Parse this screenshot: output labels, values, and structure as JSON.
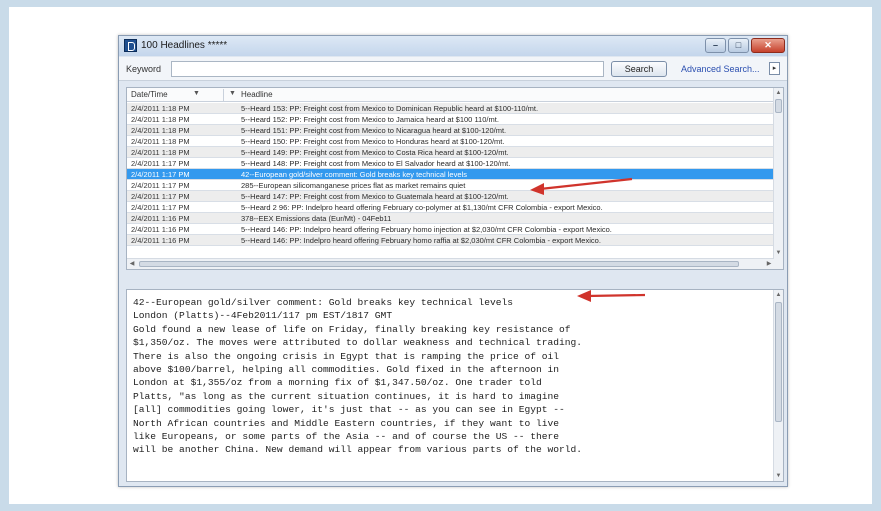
{
  "window": {
    "title": "100 Headlines *****",
    "min_glyph": "–",
    "max_glyph": "□",
    "close_glyph": "✕"
  },
  "toolbar": {
    "keyword_label": "Keyword",
    "keyword_value": "",
    "search_label": "Search",
    "advanced_label": "Advanced Search...",
    "dropdown_glyph": "▸"
  },
  "headlines": {
    "columns": {
      "date": "Date/Time",
      "headline": "Headline",
      "sort_glyph": "▼"
    },
    "rows": [
      {
        "date": "2/4/2011 1:18 PM",
        "headline": "5--Heard 153: PP: Freight cost from Mexico to Dominican Republic heard at $100-110/mt."
      },
      {
        "date": "2/4/2011 1:18 PM",
        "headline": "5--Heard 152: PP: Freight cost from Mexico to Jamaica heard at $100 110/mt."
      },
      {
        "date": "2/4/2011 1:18 PM",
        "headline": "5--Heard 151: PP: Freight cost from Mexico to Nicaragua heard at $100-120/mt."
      },
      {
        "date": "2/4/2011 1:18 PM",
        "headline": "5--Heard 150: PP: Freight cost from Mexico to Honduras heard at $100-120/mt."
      },
      {
        "date": "2/4/2011 1:18 PM",
        "headline": "5--Heard 149: PP: Freight cost from Mexico to Costa Rica heard at $100-120/mt."
      },
      {
        "date": "2/4/2011 1:17 PM",
        "headline": "5--Heard 148: PP: Freight cost from Mexico to El Salvador heard at $100-120/mt."
      },
      {
        "date": "2/4/2011 1:17 PM",
        "headline": "42--European gold/silver comment: Gold breaks key technical levels"
      },
      {
        "date": "2/4/2011 1:17 PM",
        "headline": "285--European silicomanganese prices flat as market remains quiet"
      },
      {
        "date": "2/4/2011 1:17 PM",
        "headline": "5--Heard 147: PP: Freight cost from Mexico to Guatemala heard at $100-120/mt."
      },
      {
        "date": "2/4/2011 1:17 PM",
        "headline": "5--Heard 2 96: PP: Indelpro heard offering February co-polymer at $1,130/mt CFR Colombia - export Mexico."
      },
      {
        "date": "2/4/2011 1:16 PM",
        "headline": "378--EEX Emissions data (Eur/Mt) - 04Feb11"
      },
      {
        "date": "2/4/2011 1:16 PM",
        "headline": "5--Heard 146: PP: Indelpro heard offering February homo injection at $2,030/mt CFR Colombia - export Mexico."
      },
      {
        "date": "2/4/2011 1:16 PM",
        "headline": "5--Heard 146: PP: Indelpro heard offering February homo raffia at $2,030/mt CFR Colombia - export Mexico."
      }
    ],
    "selected_index": 6
  },
  "article": {
    "lines": [
      "42--European gold/silver comment: Gold breaks key technical levels",
      "London (Platts)--4Feb2011/117 pm EST/1817 GMT",
      "Gold found a new lease of life on Friday, finally breaking key resistance of",
      "$1,350/oz. The moves were attributed to dollar weakness and technical trading.",
      "There is also the ongoing crisis in Egypt that is ramping the price of oil",
      "above $100/barrel, helping all commodities. Gold fixed in the afternoon in",
      "London at $1,355/oz from a morning fix of $1,347.50/oz. One trader told",
      "Platts, \"as long as the current situation continues, it is hard to imagine",
      "[all] commodities going lower, it's just that -- as you can see in Egypt --",
      "North African countries and Middle Eastern countries, if they want to live",
      "like Europeans, or some parts of the Asia -- and of course the US -- there",
      "will be another China. New demand will appear from various parts of the world."
    ]
  },
  "colors": {
    "selection": "#3399ee",
    "annotation_arrow": "#d0342c",
    "background": "#c9dbe9",
    "link": "#2b4fb0"
  },
  "scrollbar_glyphs": {
    "up": "▲",
    "down": "▼",
    "left": "◀",
    "right": "▶"
  }
}
